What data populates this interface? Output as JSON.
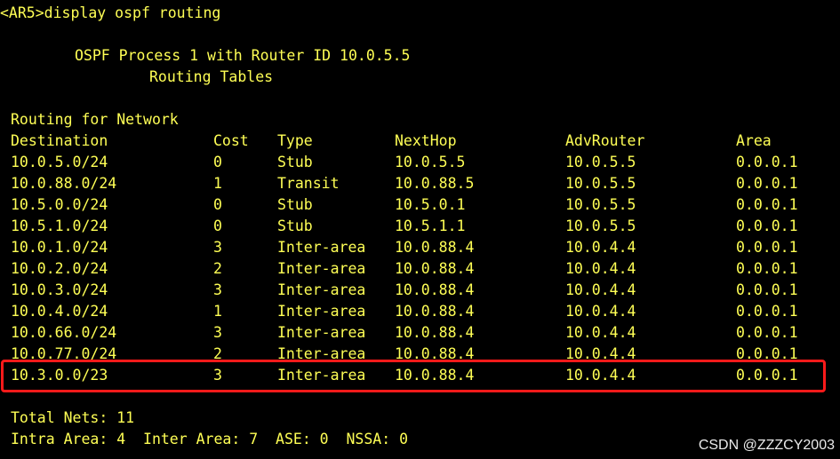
{
  "terminal": {
    "prompt_line": "<AR5>display ospf routing",
    "process_line": "OSPF Process 1 with Router ID 10.0.5.5",
    "tables_line": "Routing Tables",
    "section_title": "Routing for Network",
    "headers": {
      "destination": "Destination",
      "cost": "Cost",
      "type": "Type",
      "nexthop": "NextHop",
      "advrouter": "AdvRouter",
      "area": "Area"
    },
    "rows": [
      {
        "destination": "10.0.5.0/24",
        "cost": "0",
        "type": "Stub",
        "nexthop": "10.0.5.5",
        "advrouter": "10.0.5.5",
        "area": "0.0.0.1"
      },
      {
        "destination": "10.0.88.0/24",
        "cost": "1",
        "type": "Transit",
        "nexthop": "10.0.88.5",
        "advrouter": "10.0.5.5",
        "area": "0.0.0.1"
      },
      {
        "destination": "10.5.0.0/24",
        "cost": "0",
        "type": "Stub",
        "nexthop": "10.5.0.1",
        "advrouter": "10.0.5.5",
        "area": "0.0.0.1"
      },
      {
        "destination": "10.5.1.0/24",
        "cost": "0",
        "type": "Stub",
        "nexthop": "10.5.1.1",
        "advrouter": "10.0.5.5",
        "area": "0.0.0.1"
      },
      {
        "destination": "10.0.1.0/24",
        "cost": "3",
        "type": "Inter-area",
        "nexthop": "10.0.88.4",
        "advrouter": "10.0.4.4",
        "area": "0.0.0.1"
      },
      {
        "destination": "10.0.2.0/24",
        "cost": "2",
        "type": "Inter-area",
        "nexthop": "10.0.88.4",
        "advrouter": "10.0.4.4",
        "area": "0.0.0.1"
      },
      {
        "destination": "10.0.3.0/24",
        "cost": "3",
        "type": "Inter-area",
        "nexthop": "10.0.88.4",
        "advrouter": "10.0.4.4",
        "area": "0.0.0.1"
      },
      {
        "destination": "10.0.4.0/24",
        "cost": "1",
        "type": "Inter-area",
        "nexthop": "10.0.88.4",
        "advrouter": "10.0.4.4",
        "area": "0.0.0.1"
      },
      {
        "destination": "10.0.66.0/24",
        "cost": "3",
        "type": "Inter-area",
        "nexthop": "10.0.88.4",
        "advrouter": "10.0.4.4",
        "area": "0.0.0.1"
      },
      {
        "destination": "10.0.77.0/24",
        "cost": "2",
        "type": "Inter-area",
        "nexthop": "10.0.88.4",
        "advrouter": "10.0.4.4",
        "area": "0.0.0.1"
      },
      {
        "destination": "10.3.0.0/23",
        "cost": "3",
        "type": "Inter-area",
        "nexthop": "10.0.88.4",
        "advrouter": "10.0.4.4",
        "area": "0.0.0.1"
      }
    ],
    "total_nets_line": "Total Nets: 11",
    "summary_line": "Intra Area: 4  Inter Area: 7  ASE: 0  NSSA: 0"
  },
  "highlight": {
    "color": "#ff1a1a",
    "row_index": 10
  },
  "colors": {
    "background": "#000000",
    "text": "#ffff55"
  },
  "watermark": "CSDN @ZZZCY2003"
}
